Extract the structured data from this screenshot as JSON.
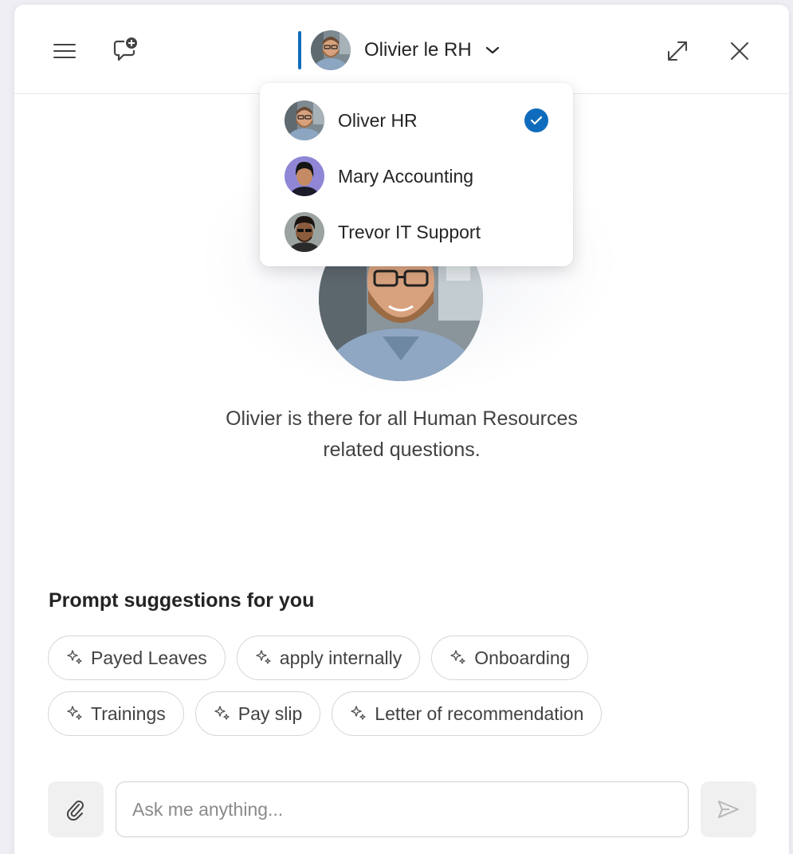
{
  "header": {
    "current_persona": "Olivier le RH",
    "icons": {
      "menu": "hamburger-menu-icon",
      "new_chat": "new-chat-icon",
      "expand": "expand-icon",
      "close": "close-icon"
    }
  },
  "dropdown": {
    "items": [
      {
        "label": "Oliver HR",
        "selected": true
      },
      {
        "label": "Mary Accounting",
        "selected": false
      },
      {
        "label": "Trevor IT Support",
        "selected": false
      }
    ]
  },
  "hero": {
    "description": "Olivier is there for all Human Resources related questions."
  },
  "suggestions": {
    "title": "Prompt suggestions for you",
    "chips": [
      "Payed Leaves",
      "apply internally",
      "Onboarding",
      "Trainings",
      "Pay slip",
      "Letter of recommendation"
    ]
  },
  "composer": {
    "placeholder": "Ask me anything..."
  },
  "colors": {
    "accent": "#0f6cbd",
    "panel_bg": "#ffffff",
    "page_bg": "#eeeef4"
  }
}
